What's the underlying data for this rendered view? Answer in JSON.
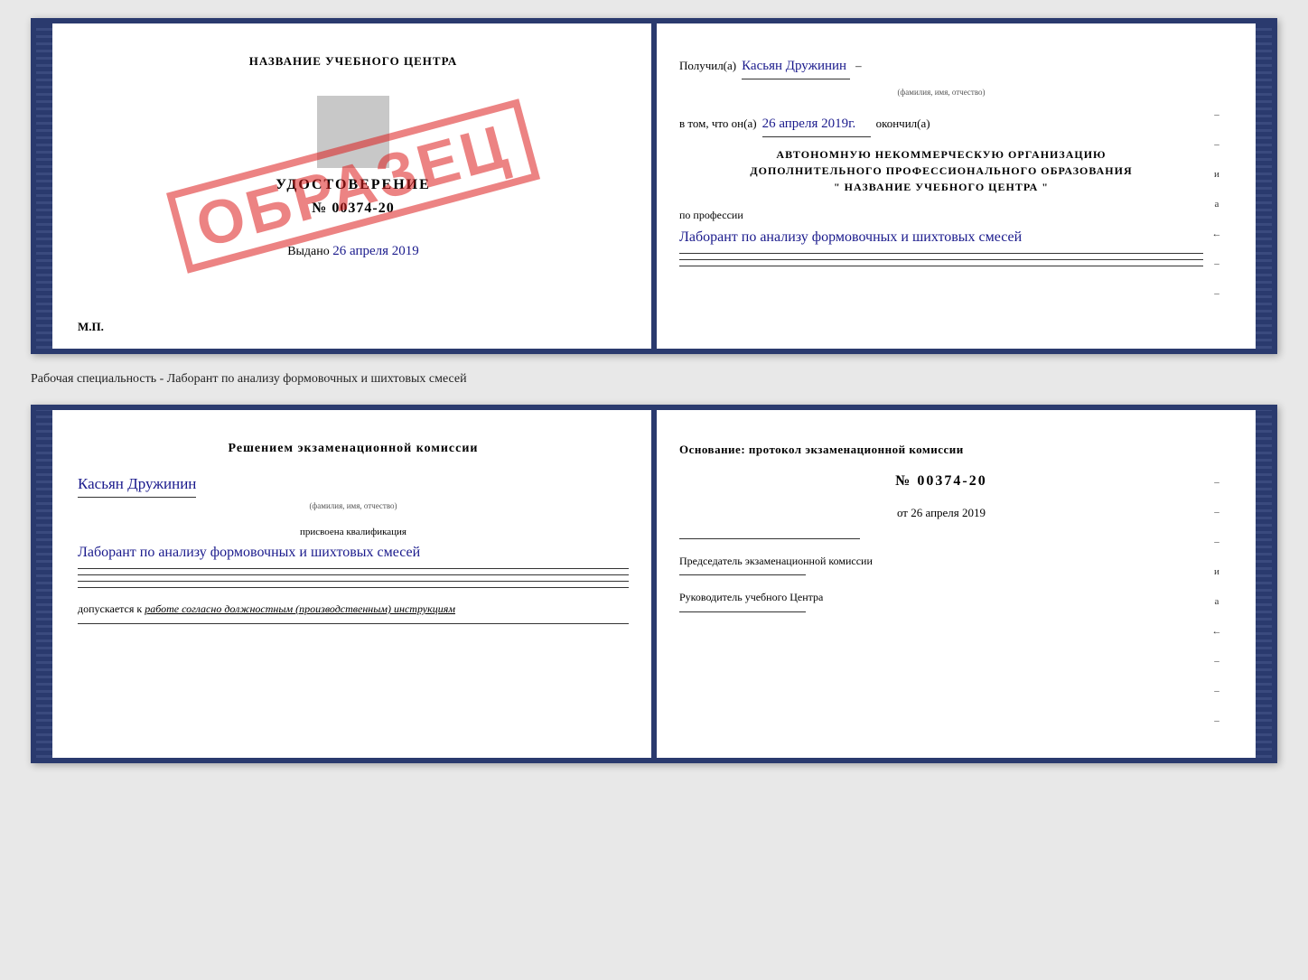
{
  "book1": {
    "left": {
      "title": "НАЗВАНИЕ УЧЕБНОГО ЦЕНТРА",
      "cert_type": "УДОСТОВЕРЕНИЕ",
      "cert_number": "№ 00374-20",
      "issued_label": "Выдано",
      "issued_date": "26 апреля 2019",
      "stamp": "ОБРАЗЕЦ",
      "mp_label": "М.П."
    },
    "right": {
      "received_label": "Получил(а)",
      "name_handwritten": "Касьян Дружинин",
      "name_subtitle": "(фамилия, имя, отчество)",
      "completed_prefix": "в том, что он(а)",
      "completed_date_hw": "26 апреля 2019г.",
      "completed_suffix": "окончил(а)",
      "org_line1": "АВТОНОМНУЮ НЕКОММЕРЧЕСКУЮ ОРГАНИЗАЦИЮ",
      "org_line2": "ДОПОЛНИТЕЛЬНОГО ПРОФЕССИОНАЛЬНОГО ОБРАЗОВАНИЯ",
      "org_line3": "\"  НАЗВАНИЕ УЧЕБНОГО ЦЕНТРА  \"",
      "profession_prefix": "по профессии",
      "profession_hw": "Лаборант по анализу формовочных и шихтовых смесей",
      "side_chars": [
        "–",
        "–",
        "и",
        "а",
        "←",
        "–",
        "–"
      ]
    }
  },
  "specialty_line": "Рабочая специальность - Лаборант по анализу формовочных и шихтовых смесей",
  "book2": {
    "left": {
      "section_title": "Решением экзаменационной комиссии",
      "name_handwritten": "Касьян Дружинин",
      "name_subtitle": "(фамилия, имя, отчество)",
      "qualification_label": "присвоена квалификация",
      "qualification_hw": "Лаборант по анализу формовочных и шихтовых смесей",
      "admission_prefix": "допускается к",
      "admission_text": "работе согласно должностным (производственным) инструкциям"
    },
    "right": {
      "basis_label": "Основание: протокол экзаменационной комиссии",
      "number": "№ 00374-20",
      "date_prefix": "от",
      "date": "26 апреля 2019",
      "chairman_label": "Председатель экзаменационной комиссии",
      "director_label": "Руководитель учебного Центра",
      "side_chars": [
        "–",
        "–",
        "–",
        "и",
        "а",
        "←",
        "–",
        "–",
        "–"
      ]
    }
  }
}
